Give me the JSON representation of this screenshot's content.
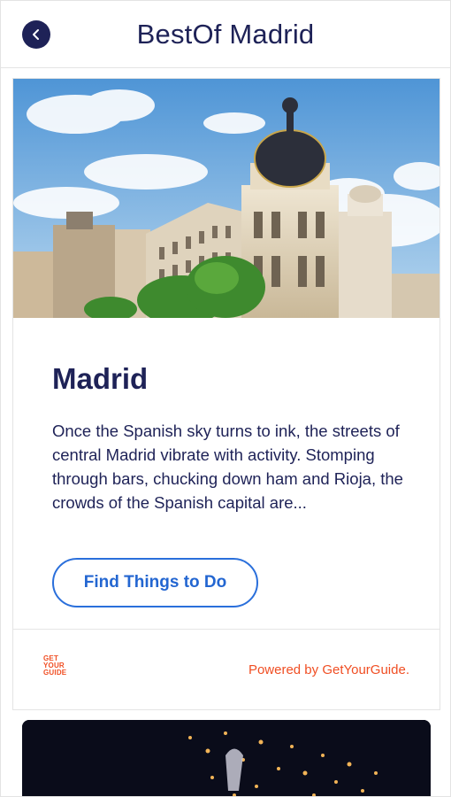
{
  "header": {
    "title": "BestOf Madrid",
    "back_icon": "chevron-left-icon",
    "accent": "#1e2257"
  },
  "card": {
    "title": "Madrid",
    "description": "Once the Spanish sky turns to ink, the streets of central Madrid vibrate with activity. Stomping through bars, chucking down ham and Rioja, the crowds of the Spanish capital are...",
    "cta_label": "Find Things to Do",
    "cta_color": "#2a6fdb",
    "footer": {
      "logo_lines": [
        "GET",
        "YOUR",
        "GUIDE"
      ],
      "powered_by": "Powered by GetYourGuide.",
      "brand_color": "#f04e23"
    }
  }
}
